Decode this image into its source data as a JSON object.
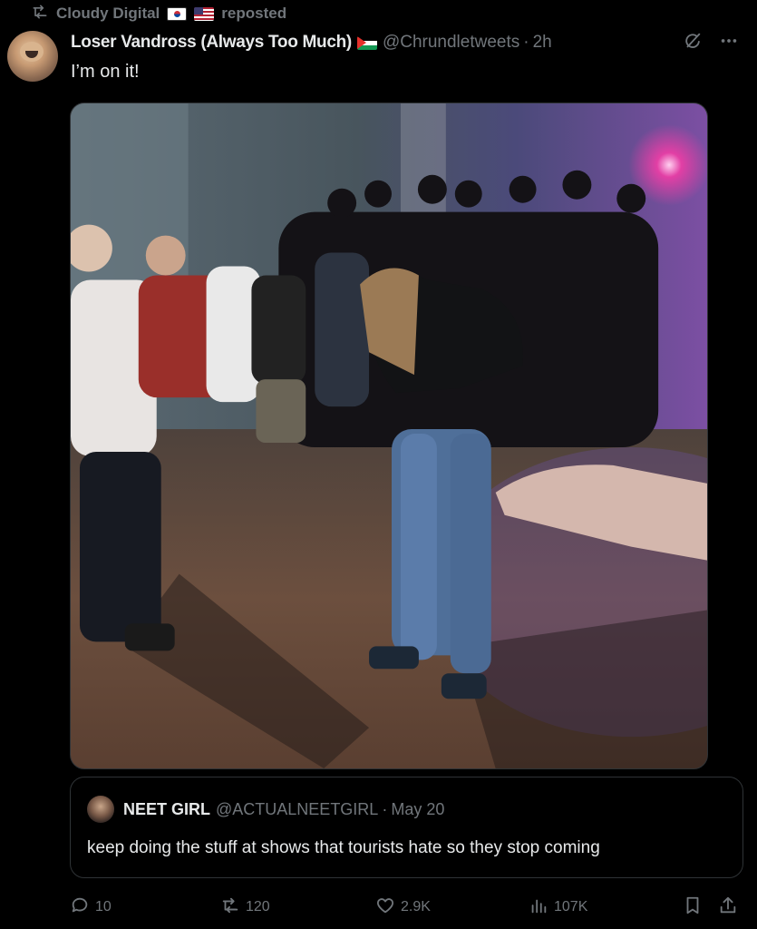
{
  "repost": {
    "user": "Cloudy Digital",
    "label": "reposted"
  },
  "tweet": {
    "display_name": "Loser Vandross (Always Too Much)",
    "handle": "@Chrundletweets",
    "separator": "·",
    "time": "2h",
    "text": "I’m on it!"
  },
  "quote": {
    "display_name": "NEET GIRL",
    "handle": "@ACTUALNEETGIRL",
    "separator": "·",
    "date": "May 20",
    "text": "keep doing the stuff at shows that tourists hate so they stop coming"
  },
  "actions": {
    "replies": "10",
    "reposts": "120",
    "likes": "2.9K",
    "views": "107K"
  },
  "icons": {
    "repost_line": "repost-icon",
    "flags": [
      "south-korea-flag",
      "united-states-flag",
      "palestine-flag"
    ],
    "header": [
      "grok-icon",
      "more-icon"
    ],
    "bar": [
      "reply-icon",
      "repost-icon",
      "like-icon",
      "views-icon",
      "bookmark-icon",
      "share-icon"
    ]
  },
  "colors": {
    "background": "#000000",
    "text": "#e7e9ea",
    "muted": "#71767b",
    "border": "#2f3336"
  }
}
